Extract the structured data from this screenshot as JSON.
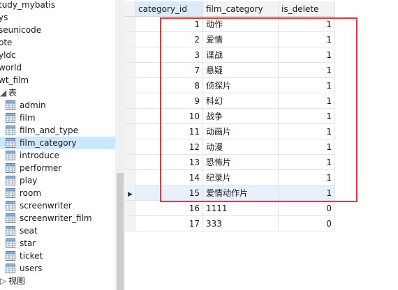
{
  "colors": {
    "selection": "#cce8ff",
    "highlight_border": "#e53935",
    "grid_line": "#e4e4e4",
    "header_bg": "#f3f3f3"
  },
  "tree": {
    "databases": [
      "tudy_mybatis",
      "ys",
      "seunicode",
      "ote",
      "yldc",
      "world",
      "wt_film"
    ],
    "tables_folder": {
      "label": "表",
      "icon": "table-folder-icon",
      "expanded": true
    },
    "tables": [
      "admin",
      "film",
      "film_and_type",
      "film_category",
      "introduce",
      "performer",
      "play",
      "room",
      "screenwriter",
      "screenwriter_film",
      "seat",
      "star",
      "ticket",
      "users"
    ],
    "selected_table": "film_category",
    "views_folder": {
      "label": "视图",
      "icon": "view-folder-icon",
      "expanded": false
    }
  },
  "grid": {
    "columns": [
      "category_id",
      "film_category",
      "is_delete"
    ],
    "rows": [
      {
        "category_id": "1",
        "film_category": "动作",
        "is_delete": "1"
      },
      {
        "category_id": "2",
        "film_category": "爱情",
        "is_delete": "1"
      },
      {
        "category_id": "3",
        "film_category": "谍战",
        "is_delete": "1"
      },
      {
        "category_id": "7",
        "film_category": "悬疑",
        "is_delete": "1"
      },
      {
        "category_id": "8",
        "film_category": "侦探片",
        "is_delete": "1"
      },
      {
        "category_id": "9",
        "film_category": "科幻",
        "is_delete": "1"
      },
      {
        "category_id": "10",
        "film_category": "战争",
        "is_delete": "1"
      },
      {
        "category_id": "11",
        "film_category": "动画片",
        "is_delete": "1"
      },
      {
        "category_id": "12",
        "film_category": "动漫",
        "is_delete": "1"
      },
      {
        "category_id": "13",
        "film_category": "恐怖片",
        "is_delete": "1"
      },
      {
        "category_id": "14",
        "film_category": "纪录片",
        "is_delete": "1"
      },
      {
        "category_id": "15",
        "film_category": "爱情动作片",
        "is_delete": "1"
      },
      {
        "category_id": "16",
        "film_category": "1111",
        "is_delete": "0"
      },
      {
        "category_id": "17",
        "film_category": "333",
        "is_delete": "0"
      }
    ],
    "current_row_index": 11
  }
}
